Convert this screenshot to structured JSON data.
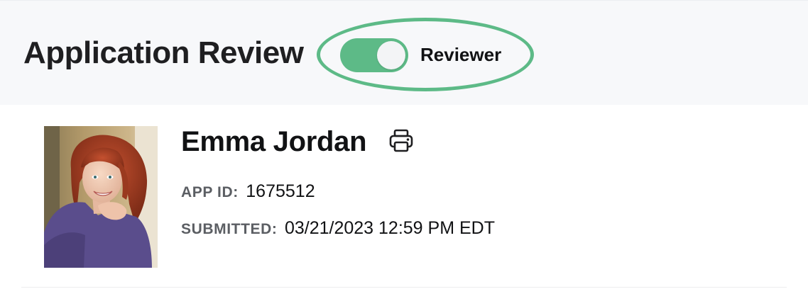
{
  "header": {
    "title": "Application Review",
    "toggle": {
      "label": "Reviewer",
      "state": "on",
      "on_color": "#5dba87"
    },
    "highlight_color": "#5dba87"
  },
  "applicant": {
    "name": "Emma Jordan",
    "app_id_label": "APP ID:",
    "app_id_value": "1675512",
    "submitted_label": "SUBMITTED:",
    "submitted_value": "03/21/2023 12:59 PM EDT",
    "avatar": "applicant-photo-woman-red-hair-purple-sweater",
    "print_icon": "printer-icon"
  }
}
